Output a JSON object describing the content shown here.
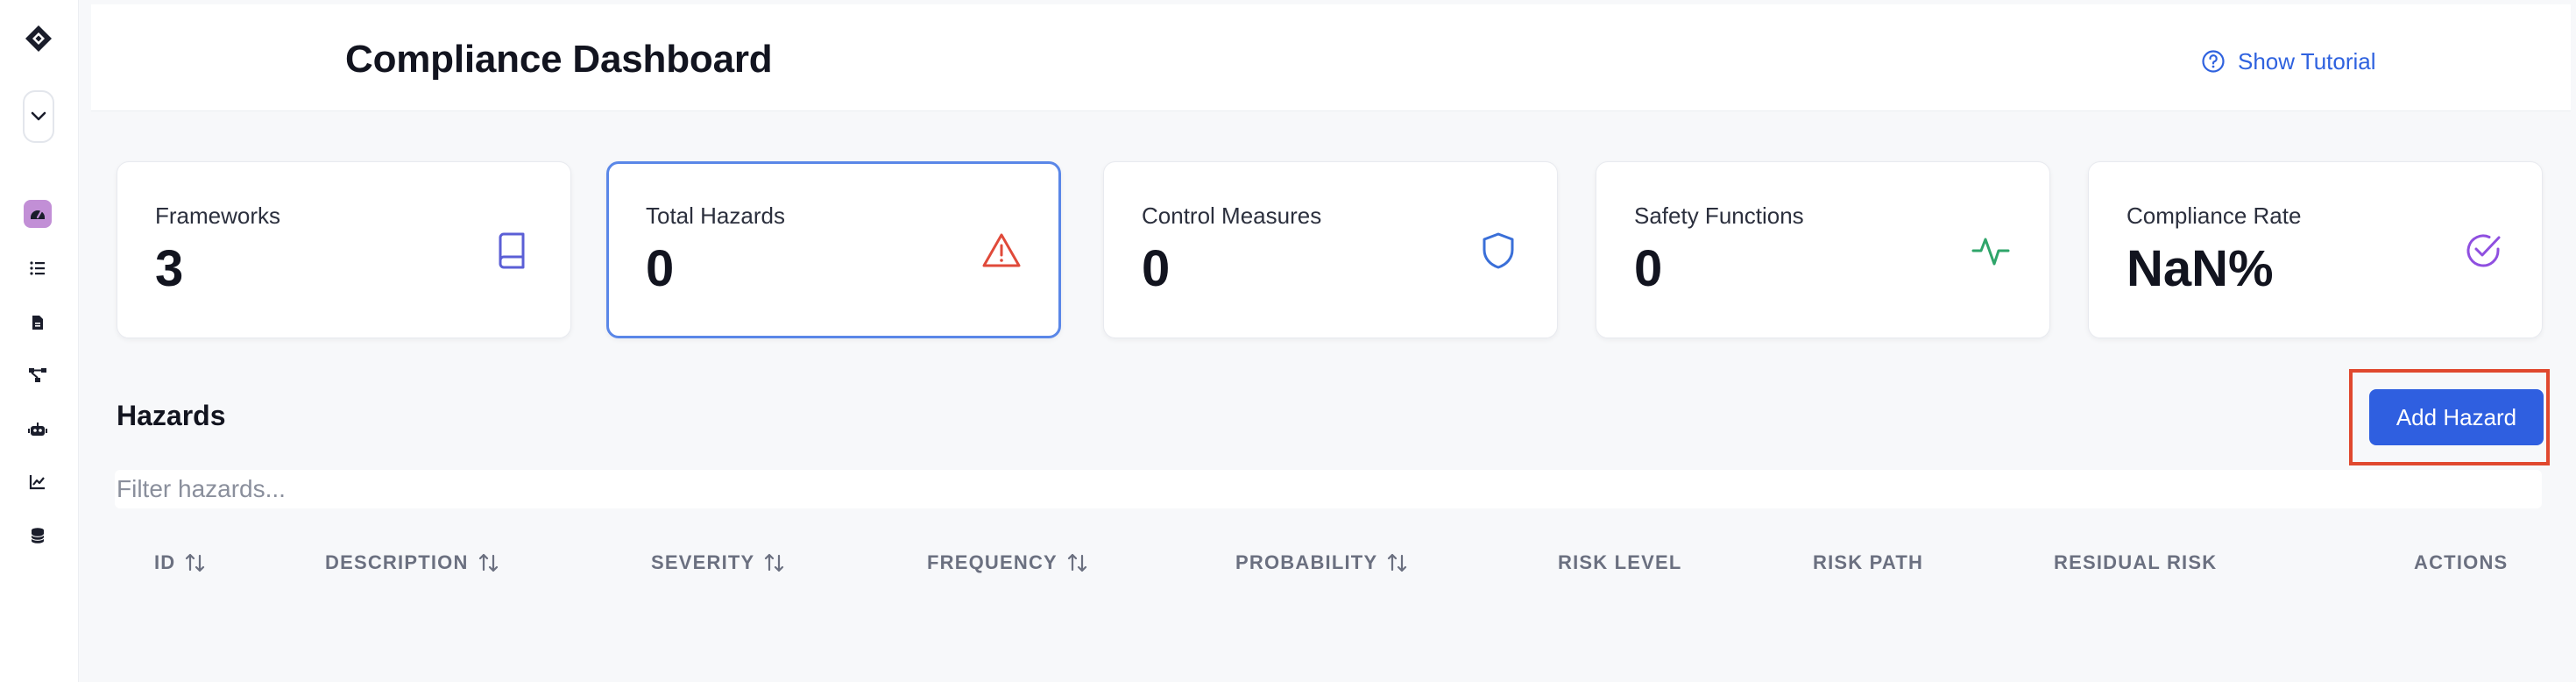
{
  "header": {
    "title": "Compliance Dashboard",
    "tutorial_label": "Show Tutorial"
  },
  "sidebar": {
    "items": [
      {
        "icon": "dashboard-icon",
        "active": true
      },
      {
        "icon": "list-icon",
        "active": false
      },
      {
        "icon": "document-icon",
        "active": false
      },
      {
        "icon": "network-icon",
        "active": false
      },
      {
        "icon": "robot-icon",
        "active": false
      },
      {
        "icon": "chart-line-icon",
        "active": false
      },
      {
        "icon": "database-icon",
        "active": false
      }
    ]
  },
  "stats": [
    {
      "label": "Frameworks",
      "value": "3",
      "icon": "book-icon",
      "color": "#5b5fd6"
    },
    {
      "label": "Total Hazards",
      "value": "0",
      "icon": "warning-icon",
      "color": "#e04a3a"
    },
    {
      "label": "Control Measures",
      "value": "0",
      "icon": "shield-icon",
      "color": "#3a6fd8"
    },
    {
      "label": "Safety Functions",
      "value": "0",
      "icon": "activity-icon",
      "color": "#2fa56a"
    },
    {
      "label": "Compliance Rate",
      "value": "NaN%",
      "icon": "check-circle-icon",
      "color": "#8f4fe0"
    }
  ],
  "hazards": {
    "title": "Hazards",
    "add_label": "Add Hazard",
    "filter_placeholder": "Filter hazards...",
    "columns": [
      "ID",
      "DESCRIPTION",
      "SEVERITY",
      "FREQUENCY",
      "PROBABILITY",
      "RISK LEVEL",
      "RISK PATH",
      "RESIDUAL RISK",
      "ACTIONS"
    ]
  },
  "colors": {
    "accent": "#2f5fe0",
    "highlight_outline": "#e0482e",
    "selected_card_border": "#5a87e8"
  }
}
